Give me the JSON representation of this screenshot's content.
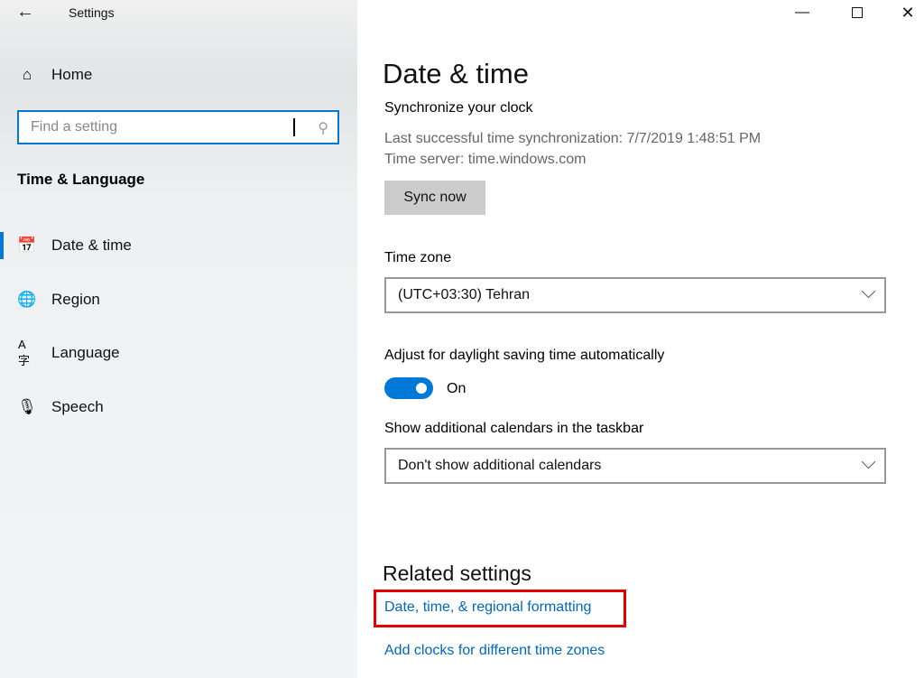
{
  "window": {
    "title": "Settings",
    "back_icon": "arrow-left-icon",
    "minimize_icon": "minimize-icon",
    "maximize_icon": "maximize-icon",
    "close_icon": "close-icon"
  },
  "sidebar": {
    "home": {
      "label": "Home",
      "icon": "home-icon"
    },
    "search": {
      "placeholder": "Find a setting",
      "icon": "search-icon"
    },
    "section": "Time & Language",
    "items": [
      {
        "label": "Date & time",
        "icon": "calendar-clock-icon",
        "selected": true
      },
      {
        "label": "Region",
        "icon": "globe-icon"
      },
      {
        "label": "Language",
        "icon": "language-icon"
      },
      {
        "label": "Speech",
        "icon": "microphone-icon"
      }
    ],
    "accent": "#0078d7"
  },
  "main": {
    "title": "Date & time",
    "sync": {
      "heading": "Synchronize your clock",
      "last_sync": "Last successful time synchronization: 7/7/2019 1:48:51 PM",
      "server": "Time server: time.windows.com",
      "button": "Sync now"
    },
    "timezone": {
      "label": "Time zone",
      "value": "(UTC+03:30) Tehran"
    },
    "dst": {
      "label": "Adjust for daylight saving time automatically",
      "state": "On",
      "on": true
    },
    "calendars": {
      "label": "Show additional calendars in the taskbar",
      "value": "Don't show additional calendars"
    },
    "related": {
      "heading": "Related settings",
      "links": [
        "Date, time, & regional formatting",
        "Add clocks for different time zones"
      ],
      "highlight_color": "#e60000"
    }
  }
}
